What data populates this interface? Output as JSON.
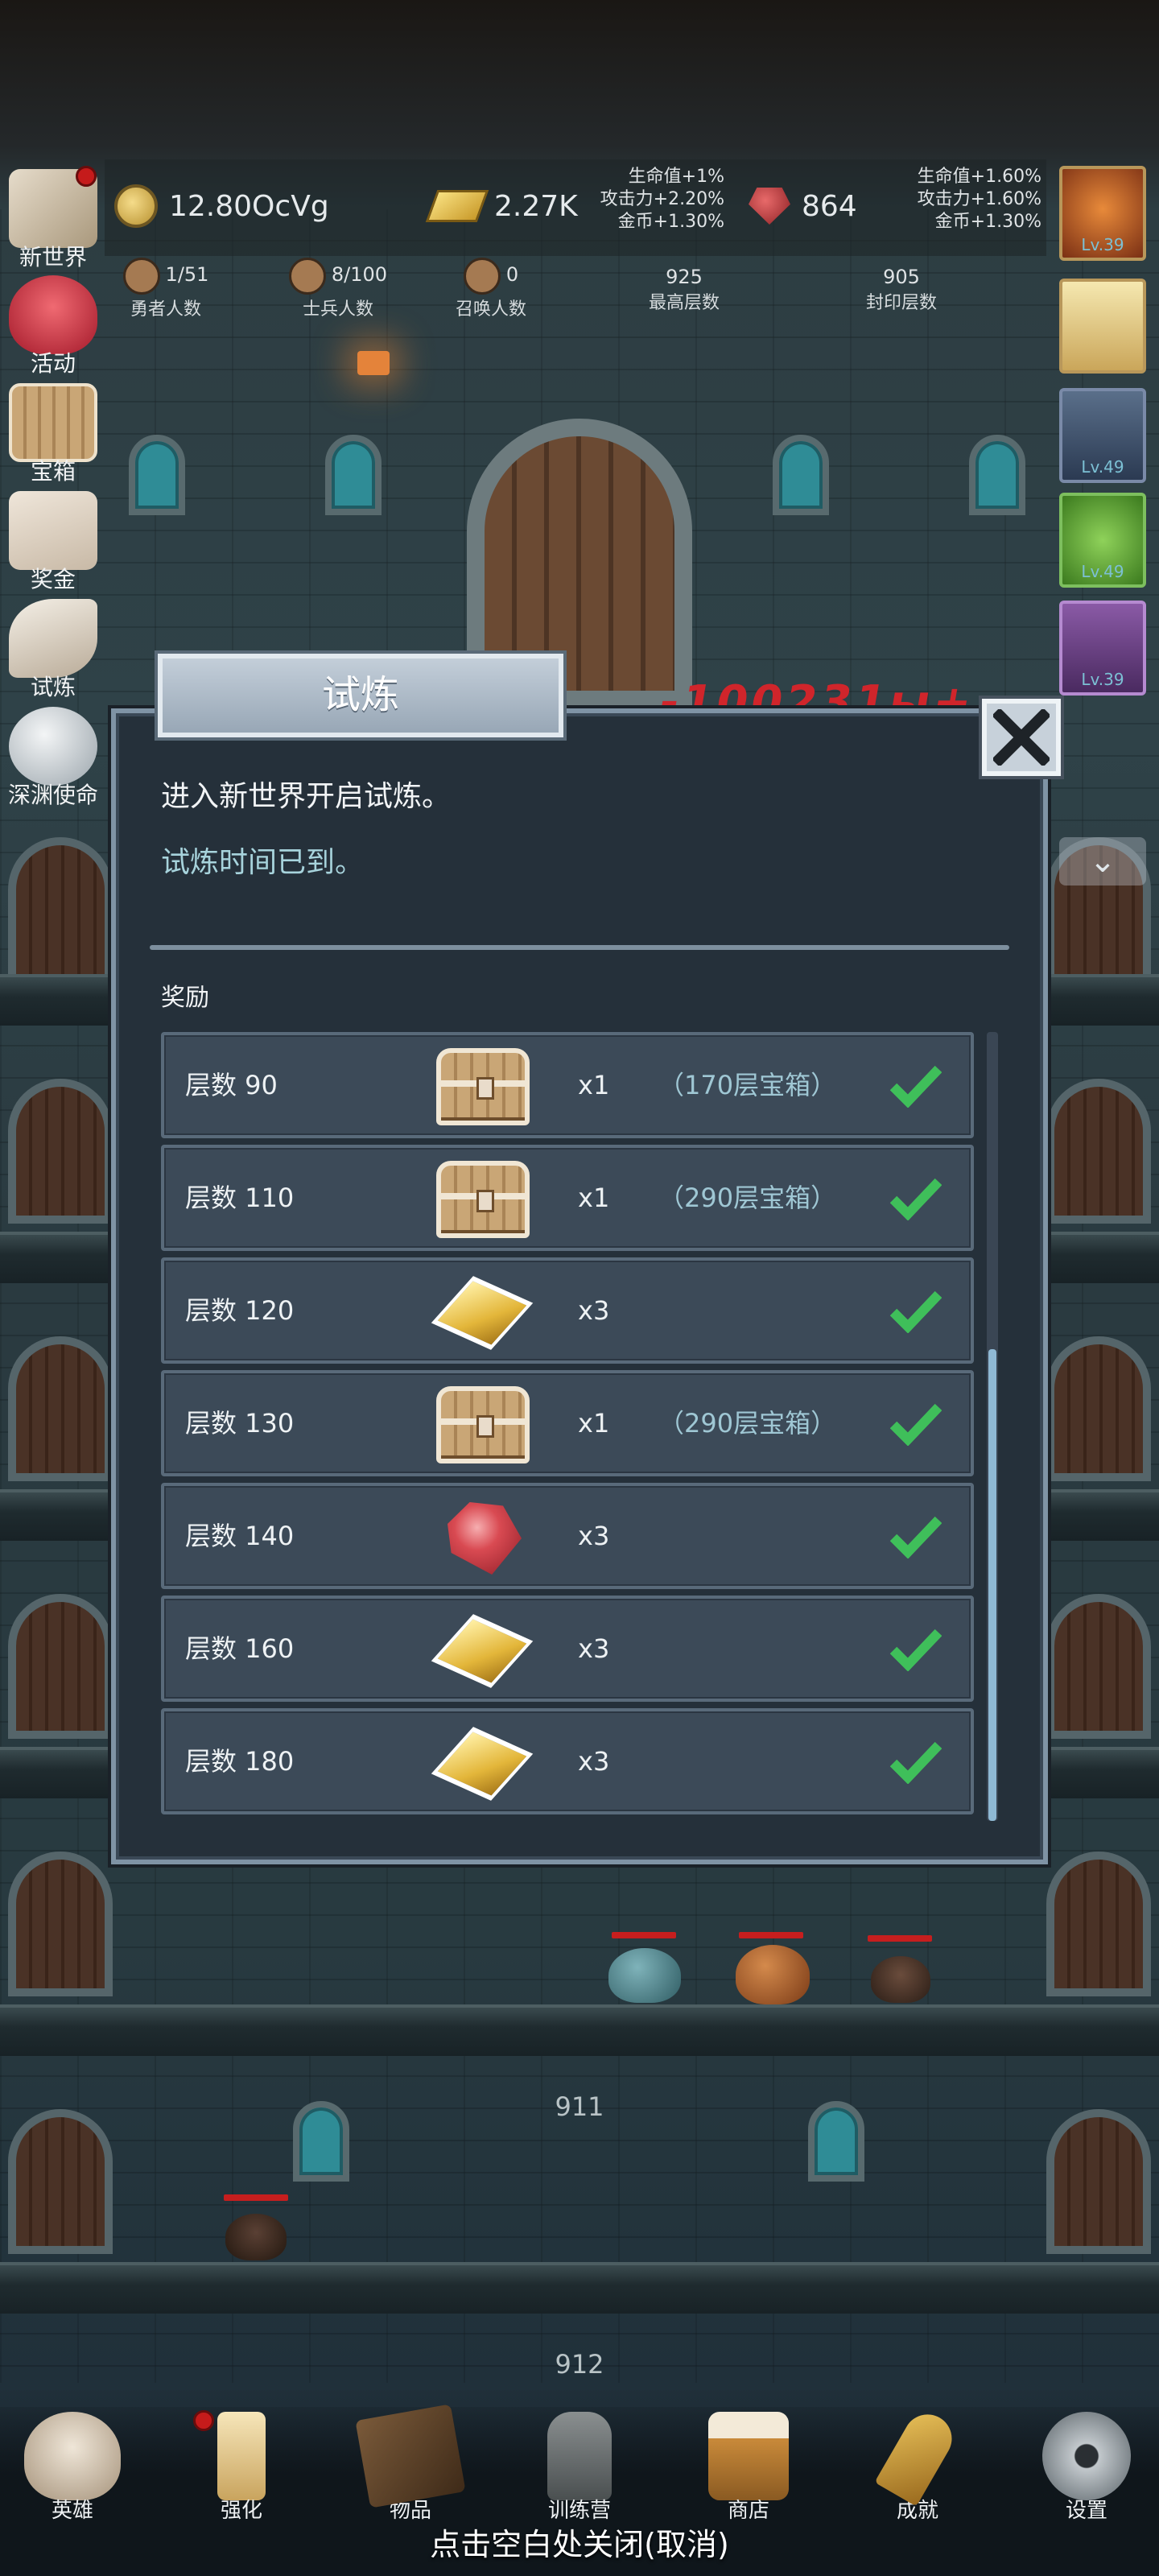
{
  "hud": {
    "coins": "12.80OcVg",
    "gold": "2.27K",
    "gems": "864",
    "gold_bonus": [
      "生命值+1%",
      "攻击力+2.20%",
      "金币+1.30%"
    ],
    "gem_bonus": [
      "生命值+1.60%",
      "攻击力+1.60%",
      "金币+1.30%"
    ],
    "stats": [
      {
        "value": "1/51",
        "label": "勇者人数"
      },
      {
        "value": "8/100",
        "label": "士兵人数"
      },
      {
        "value": "0",
        "label": "召唤人数"
      },
      {
        "value": "925",
        "label": "最高层数"
      },
      {
        "value": "905",
        "label": "封印层数"
      }
    ]
  },
  "left_menu": [
    "新世界",
    "活动",
    "宝箱",
    "奖金",
    "试炼",
    "深渊使命"
  ],
  "portraits": [
    "Lv.39",
    "",
    "Lv.49",
    "Lv.49",
    "Lv.39"
  ],
  "floor_numbers": [
    "911",
    "912"
  ],
  "modal": {
    "title": "试炼",
    "description": "进入新世界开启试炼。",
    "status": "试炼时间已到。",
    "rewards_header": "奖励",
    "rows": [
      {
        "floor": "层数 90",
        "item": "chest-icon",
        "qty": "x1",
        "note": "（170层宝箱）",
        "claimed": true
      },
      {
        "floor": "层数 110",
        "item": "chest-icon",
        "qty": "x1",
        "note": "（290层宝箱）",
        "claimed": true
      },
      {
        "floor": "层数 120",
        "item": "gold-bar-icon",
        "qty": "x3",
        "note": "",
        "claimed": true
      },
      {
        "floor": "层数 130",
        "item": "chest-icon",
        "qty": "x1",
        "note": "（290层宝箱）",
        "claimed": true
      },
      {
        "floor": "层数 140",
        "item": "ruby-icon",
        "qty": "x3",
        "note": "",
        "claimed": true
      },
      {
        "floor": "层数 160",
        "item": "gold-bar-icon",
        "qty": "x3",
        "note": "",
        "claimed": true
      },
      {
        "floor": "层数 180",
        "item": "gold-bar-icon",
        "qty": "x3",
        "note": "",
        "claimed": true
      }
    ]
  },
  "bottom_nav": [
    "英雄",
    "强化",
    "物品",
    "训练营",
    "商店",
    "成就",
    "设置"
  ],
  "close_hint": "点击空白处关闭(取消)",
  "colors": {
    "accent_check": "#3fbf5a",
    "modal_bg": "#25303a",
    "row_bg": "#3c4a58",
    "note_text": "#9fc7d4"
  }
}
